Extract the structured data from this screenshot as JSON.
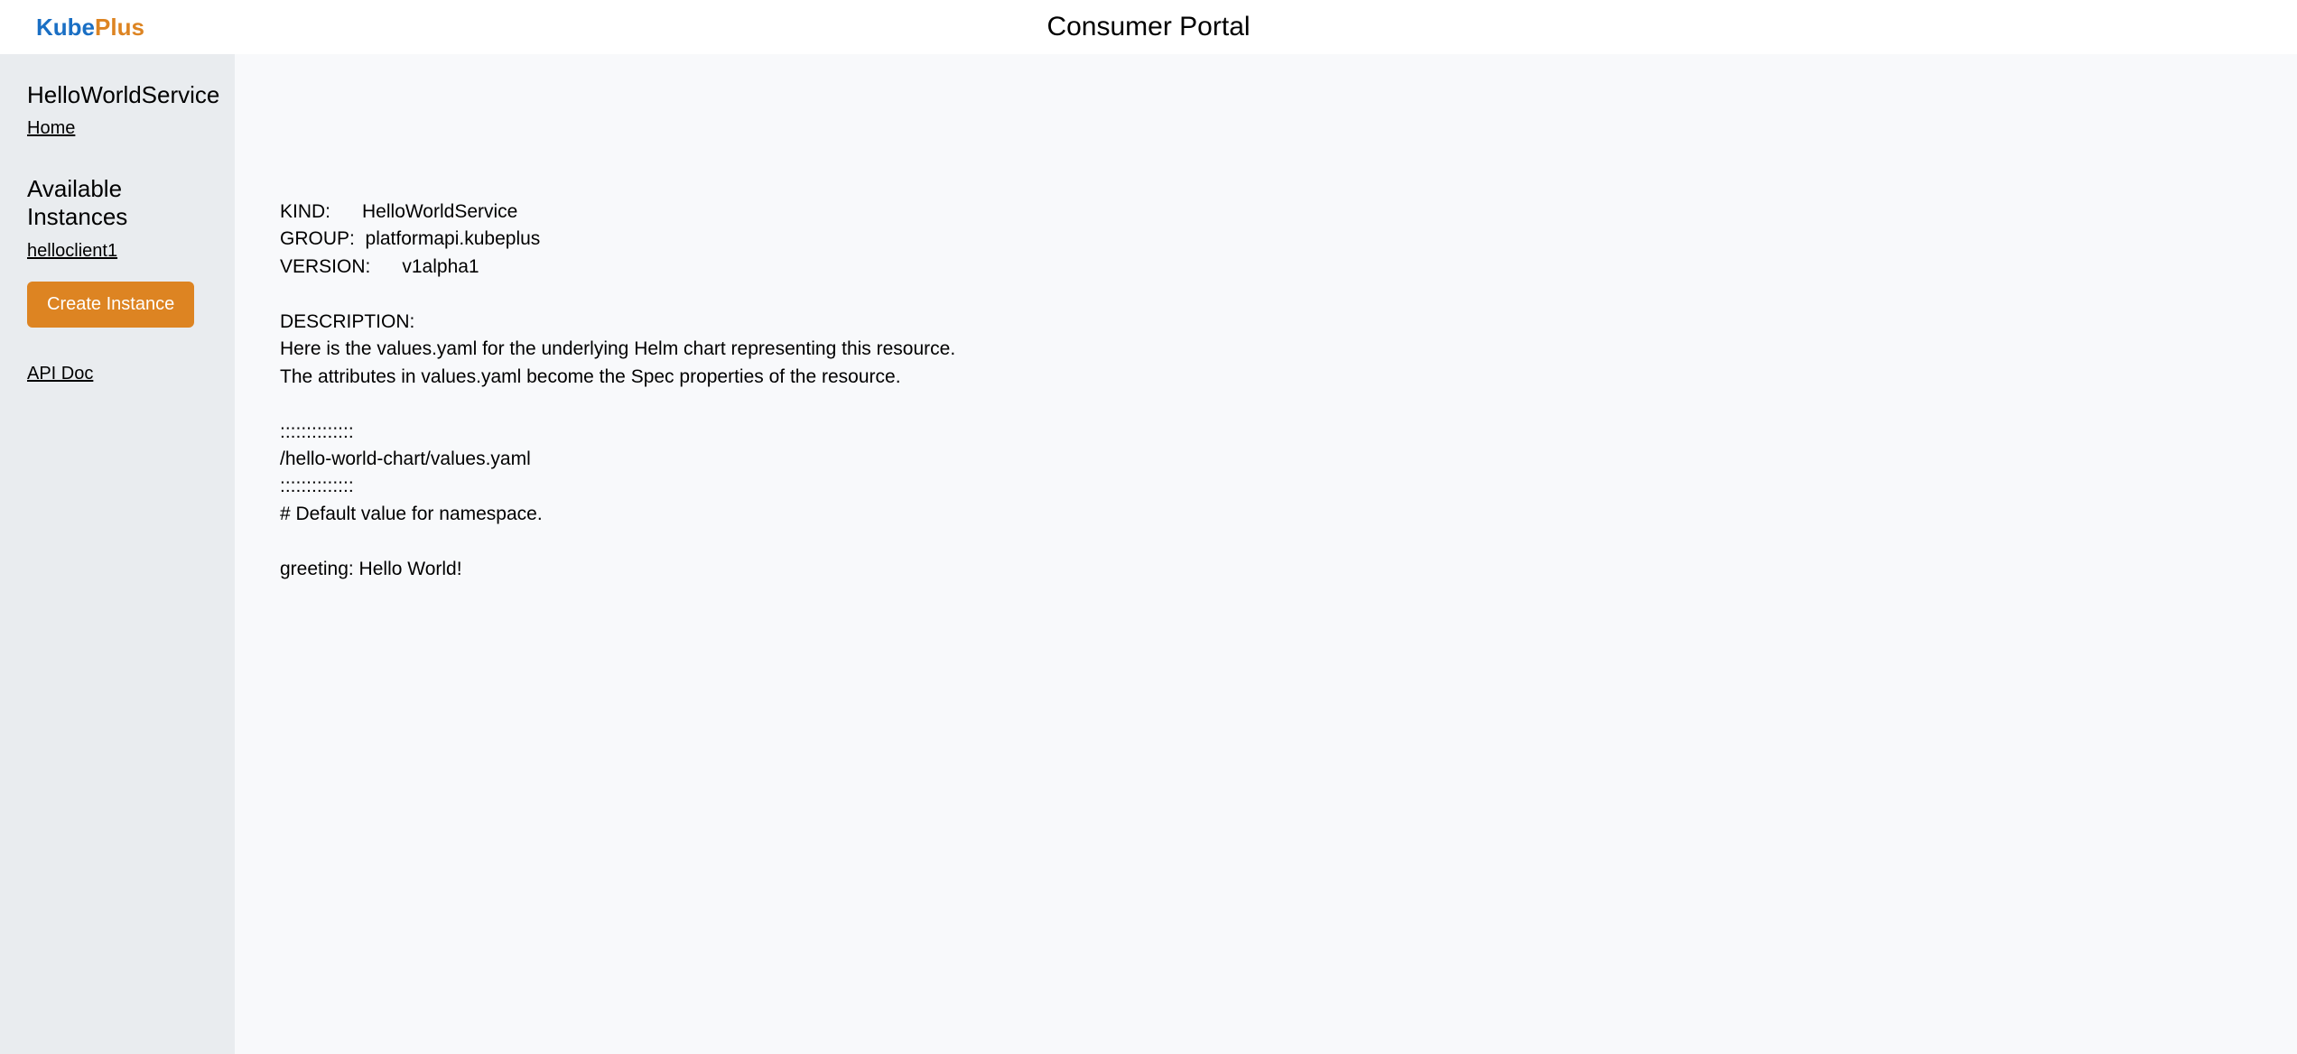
{
  "header": {
    "logo_kube": "Kube",
    "logo_plus": "Plus",
    "title": "Consumer Portal"
  },
  "sidebar": {
    "service_name": "HelloWorldService",
    "home_label": "Home",
    "instances_heading": "Available Instances",
    "instances": [
      "helloclient1"
    ],
    "create_label": "Create Instance",
    "apidoc_label": "API Doc"
  },
  "main": {
    "doc_text": "KIND:      HelloWorldService\nGROUP:  platformapi.kubeplus\nVERSION:      v1alpha1\n\nDESCRIPTION:\nHere is the values.yaml for the underlying Helm chart representing this resource.\nThe attributes in values.yaml become the Spec properties of the resource.\n\n::::::::::::::\n/hello-world-chart/values.yaml\n::::::::::::::\n# Default value for namespace.\n\ngreeting: Hello World!"
  }
}
